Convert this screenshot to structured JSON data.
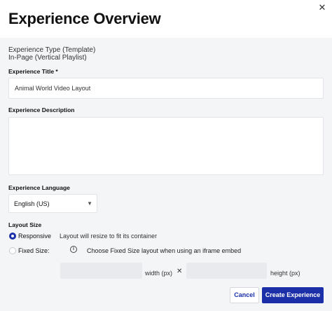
{
  "dialog": {
    "title": "Experience Overview",
    "close_glyph": "✕"
  },
  "experience_type": {
    "label": "Experience Type (Template)",
    "value": "In-Page (Vertical Playlist)"
  },
  "experience_title": {
    "label": "Experience Title *",
    "value": "Animal World Video Layout"
  },
  "experience_description": {
    "label": "Experience Description",
    "value": ""
  },
  "experience_language": {
    "label": "Experience Language",
    "selected": "English (US)",
    "arrow_glyph": "▼"
  },
  "layout_size": {
    "label": "Layout Size",
    "responsive": {
      "label": "Responsive",
      "description": "Layout will resize to fit its container",
      "selected": true
    },
    "fixed": {
      "label": "Fixed Size:",
      "info_glyph": "i",
      "description": "Choose Fixed Size layout when using an iframe embed",
      "selected": false
    },
    "width_unit": "width (px)",
    "times_glyph": "✕",
    "height_unit": "height (px)"
  },
  "actions": {
    "cancel_label": "Cancel",
    "create_label": "Create Experience"
  },
  "colors": {
    "accent": "#1a2fa8",
    "panel_bg": "#f4f5f7"
  },
  "icons": [
    "close-icon",
    "chevron-down-icon",
    "info-icon",
    "times-icon"
  ]
}
